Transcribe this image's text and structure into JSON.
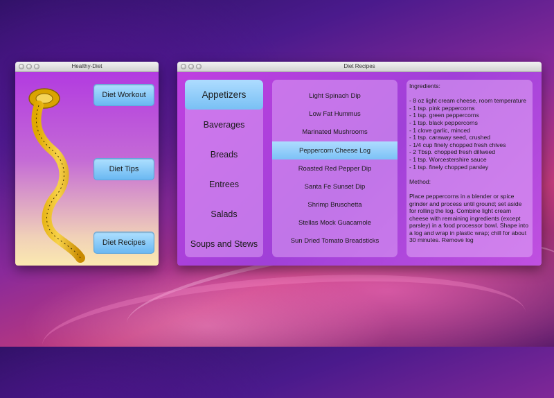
{
  "windows": {
    "healthy_diet": {
      "title": "Healthy-Diet",
      "buttons": {
        "diet_workout": "Diet Workout",
        "diet_tips": "Diet Tips",
        "diet_recipes": "Diet Recipes"
      }
    },
    "diet_recipes": {
      "title": "Diet Recipes",
      "categories": [
        {
          "label": "Appetizers",
          "selected": true
        },
        {
          "label": "Baverages"
        },
        {
          "label": "Breads"
        },
        {
          "label": "Entrees"
        },
        {
          "label": "Salads"
        },
        {
          "label": "Soups and Stews"
        }
      ],
      "recipes": [
        {
          "label": "Light Spinach Dip"
        },
        {
          "label": "Low Fat Hummus"
        },
        {
          "label": "Marinated Mushrooms"
        },
        {
          "label": "Peppercorn Cheese Log",
          "selected": true
        },
        {
          "label": "Roasted Red Pepper Dip"
        },
        {
          "label": "Santa Fe Sunset Dip"
        },
        {
          "label": "Shrimp Bruschetta"
        },
        {
          "label": "Stellas Mock Guacamole"
        },
        {
          "label": "Sun Dried Tomato Breadsticks"
        }
      ],
      "detail": "Ingredients:\n\n- 8 oz light cream cheese, room temperature\n- 1 tsp. pink peppercorns\n- 1 tsp. green peppercorns\n- 1 tsp. black peppercorns\n- 1 clove garlic, minced\n- 1 tsp. caraway seed, crushed\n- 1/4 cup finely chopped fresh chives\n- 2 Tbsp. chopped fresh dillweed\n- 1 tsp. Worcestershire sauce\n- 1 tsp. finely chopped parsley\n\nMethod:\n\nPlace peppercorns in a blender or spice grinder and process until ground; set aside for rolling the log. Combine light cream cheese with remaining ingredients (except parsley) in a food processor bowl. Shape into a log and wrap in plastic wrap; chill for about 30 minutes. Remove log"
    }
  },
  "icons": {
    "tape": "measuring-tape-icon",
    "window_controls": "traffic-light-icons"
  }
}
